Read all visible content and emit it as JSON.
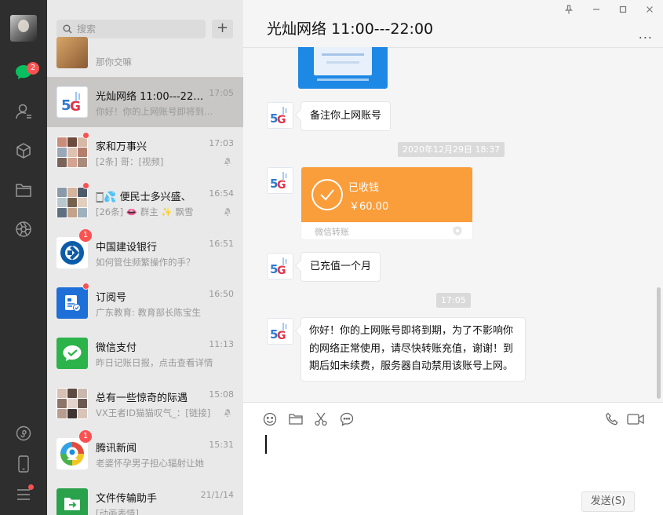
{
  "rail": {
    "badge": "2",
    "icons": [
      "chat-icon",
      "contacts-icon",
      "favorites-icon",
      "files-icon",
      "moments-icon",
      "miniprogram-icon",
      "phone-icon",
      "menu-icon"
    ]
  },
  "search": {
    "placeholder": "搜索"
  },
  "chats": [
    {
      "name": "",
      "time": "",
      "preview": "那你交嘛",
      "avatar": "photo"
    },
    {
      "name": "光灿网络 11:00---22:00",
      "time": "17:05",
      "preview": "你好！你的上网账号即将到期，为了不影响",
      "avatar": "5g",
      "active": true
    },
    {
      "name": "家和万事兴",
      "time": "17:03",
      "preview": "[2条] 哥：[视频]",
      "avatar": "grid",
      "muted": true,
      "dot": true
    },
    {
      "name": "🀆💦 便民士多兴盛、",
      "time": "16:54",
      "preview": "[26条] 👄 群主 ✨ 飘雪",
      "avatar": "grid",
      "muted": true,
      "dot": true
    },
    {
      "name": "中国建设银行",
      "time": "16:51",
      "preview": "如何管住频繁操作的手？",
      "avatar": "ccb",
      "badge": "1"
    },
    {
      "name": "订阅号",
      "time": "16:50",
      "preview": "广东教育: 教育部长陈宝生",
      "avatar": "sub",
      "dot": true
    },
    {
      "name": "微信支付",
      "time": "11:13",
      "preview": "昨日记账日报，点击查看详情",
      "avatar": "pay"
    },
    {
      "name": "总有一些惊奇的际遇",
      "time": "15:08",
      "preview": "VX王者ID猫猫叹气_：[链接]",
      "avatar": "grid",
      "muted": true
    },
    {
      "name": "腾讯新闻",
      "time": "15:31",
      "preview": "老婆怀孕男子担心辐射让她",
      "avatar": "news",
      "badge": "1"
    },
    {
      "name": "文件传输助手",
      "time": "21/1/14",
      "preview": "[动画表情]",
      "avatar": "file"
    }
  ],
  "conversation": {
    "title": "光灿网络 11:00---22:00",
    "more": "...",
    "messages": [
      {
        "type": "image"
      },
      {
        "type": "text",
        "text": "备注你上网账号"
      },
      {
        "type": "timestamp",
        "text": "2020年12月29日 18:37"
      },
      {
        "type": "transfer",
        "status": "已收钱",
        "amount": "￥60.00",
        "label": "微信转账"
      },
      {
        "type": "text",
        "text": "已充值一个月"
      },
      {
        "type": "timestamp",
        "text": "17:05"
      },
      {
        "type": "text",
        "text": "你好！你的上网账号即将到期，为了不影响你的网络正常使用，请尽快转账充值，谢谢！到期后如未续费，服务器自动禁用该账号上网。"
      }
    ]
  },
  "composer": {
    "tools": [
      "emoji-icon",
      "folder-icon",
      "scissors-icon",
      "comment-icon",
      "phone-call-icon",
      "video-call-icon"
    ],
    "send_label": "发送(S)"
  },
  "colors": {
    "rail": "#2e2e2e",
    "list": "#e9e9e9",
    "active_row": "#c8c7c6",
    "badge": "#fa5151",
    "transfer": "#fa9d3b",
    "wechat_green": "#07c160"
  }
}
